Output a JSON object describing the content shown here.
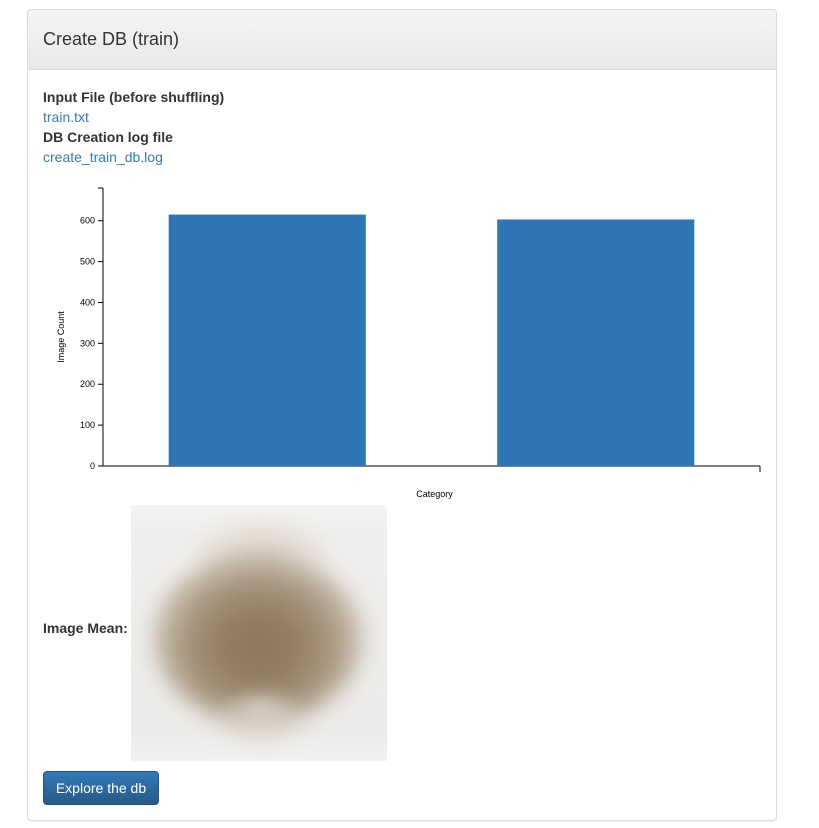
{
  "panel": {
    "title": "Create DB (train)"
  },
  "info": {
    "input_label": "Input File (before shuffling)",
    "input_link": "train.txt",
    "log_label": "DB Creation log file",
    "log_link": "create_train_db.log"
  },
  "colors": {
    "bar": "#2e75b3",
    "link": "#337ab7",
    "button": "#2a6ba3"
  },
  "chart_data": {
    "type": "bar",
    "categories": [
      "",
      ""
    ],
    "values": [
      615,
      603
    ],
    "xlabel": "Category",
    "ylabel": "Image Count",
    "ylim": [
      0,
      680
    ],
    "yticks": [
      0,
      100,
      200,
      300,
      400,
      500,
      600
    ],
    "grid": false
  },
  "mean": {
    "label": "Image Mean:"
  },
  "actions": {
    "explore_label": "Explore the db"
  }
}
